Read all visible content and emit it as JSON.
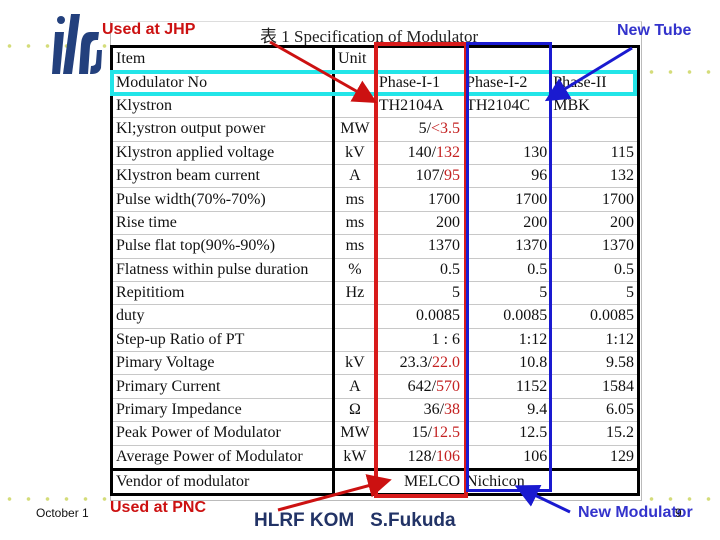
{
  "slide": {
    "date": "October 1",
    "footer_title": "HLRF KOM   S.Fukuda",
    "page_number": "9",
    "logo_text": "ilc"
  },
  "annotations": {
    "used_at_jhp": "Used at JHP",
    "used_at_pnc": "Used at PNC",
    "new_tube": "New Tube",
    "new_modulator": "New Modulator",
    "colors": {
      "phase_i_1_box": "#d81b1b",
      "phase_i_2_box": "#1a1ad0",
      "modulator_row_box": "#22e5e8",
      "annotation_red": "#cc1111",
      "annotation_blue": "#3333cc",
      "footer_navy": "#223366",
      "revised_value_red": "#c42222"
    }
  },
  "table": {
    "caption": "表 1 Specification of Modulator",
    "headers": {
      "item": "Item",
      "unit": "Unit",
      "col1": "",
      "col2": "",
      "col3": ""
    },
    "rows": [
      {
        "item": "Modulator No",
        "unit": "",
        "v1": "Phase-I-1",
        "v1r": "",
        "v2": "Phase-I-2",
        "v3": "Phase-II"
      },
      {
        "item": "Klystron",
        "unit": "",
        "v1": "TH2104A",
        "v1r": "",
        "v2": "TH2104C",
        "v3": "MBK"
      },
      {
        "item": "Kl;ystron output power",
        "unit": "MW",
        "v1": "5/",
        "v1r": "<3.5",
        "v2": "",
        "v3": ""
      },
      {
        "item": "Klystron applied voltage",
        "unit": "kV",
        "v1": "140/",
        "v1r": "132",
        "v2": "130",
        "v3": "115"
      },
      {
        "item": "Klystron beam current",
        "unit": "A",
        "v1": "107/",
        "v1r": "95",
        "v2": "96",
        "v3": "132"
      },
      {
        "item": "Pulse width(70%-70%)",
        "unit": "ms",
        "v1": "1700",
        "v1r": "",
        "v2": "1700",
        "v3": "1700"
      },
      {
        "item": "Rise time",
        "unit": "ms",
        "v1": "200",
        "v1r": "",
        "v2": "200",
        "v3": "200"
      },
      {
        "item": "Pulse flat top(90%-90%)",
        "unit": "ms",
        "v1": "1370",
        "v1r": "",
        "v2": "1370",
        "v3": "1370"
      },
      {
        "item": "Flatness within pulse duration",
        "unit": "%",
        "v1": "0.5",
        "v1r": "",
        "v2": "0.5",
        "v3": "0.5"
      },
      {
        "item": "Repititiom",
        "unit": "Hz",
        "v1": "5",
        "v1r": "",
        "v2": "5",
        "v3": "5"
      },
      {
        "item": "duty",
        "unit": "",
        "v1": "0.0085",
        "v1r": "",
        "v2": "0.0085",
        "v3": "0.0085"
      },
      {
        "item": "Step-up Ratio of  PT",
        "unit": "",
        "v1": "1 : 6",
        "v1r": "",
        "v2": "1:12",
        "v3": "1:12"
      },
      {
        "item": "Pimary Voltage",
        "unit": "kV",
        "v1": "23.3/",
        "v1r": "22.0",
        "v2": "10.8",
        "v3": "9.58"
      },
      {
        "item": "Primary Current",
        "unit": "A",
        "v1": "642/",
        "v1r": "570",
        "v2": "1152",
        "v3": "1584"
      },
      {
        "item": "Primary Impedance",
        "unit": "Ω",
        "v1": "36/",
        "v1r": "38",
        "v2": "9.4",
        "v3": "6.05"
      },
      {
        "item": "Peak Power of Modulator",
        "unit": "MW",
        "v1": "15/",
        "v1r": "12.5",
        "v2": "12.5",
        "v3": "15.2"
      },
      {
        "item": "Average Power of Modulator",
        "unit": "kW",
        "v1": "128/",
        "v1r": "106",
        "v2": "106",
        "v3": "129"
      }
    ],
    "vendor_row": {
      "item": "Vendor of modulator",
      "unit": "",
      "v1": "MELCO",
      "v2": "Nichicon",
      "v3": ""
    }
  }
}
